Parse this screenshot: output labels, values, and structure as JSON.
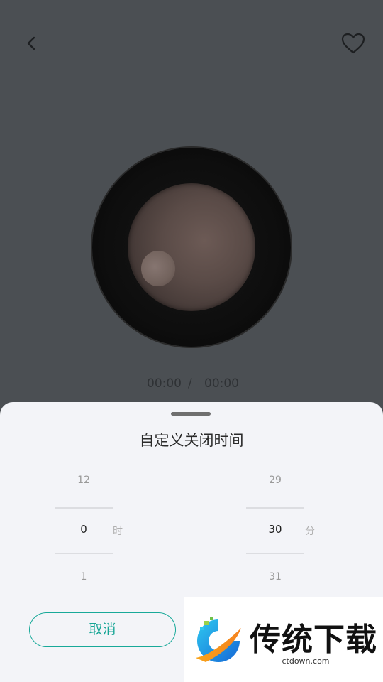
{
  "player": {
    "time_current": "00:00",
    "time_separator": "/",
    "time_total": "00:00"
  },
  "sheet": {
    "title": "自定义关闭时间",
    "hours": {
      "prev": "12",
      "selected": "0",
      "next": "1",
      "unit": "时"
    },
    "minutes": {
      "prev": "29",
      "selected": "30",
      "next": "31",
      "unit": "分"
    },
    "cancel_label": "取消"
  },
  "watermark": {
    "brand": "传统下载",
    "url": "ctdown.com"
  },
  "colors": {
    "accent": "#18a999",
    "backdrop": "#4b4f53",
    "sheet_bg": "#f3f4f8"
  },
  "icons": {
    "back": "chevron-left-icon",
    "favorite": "heart-outline-icon"
  }
}
